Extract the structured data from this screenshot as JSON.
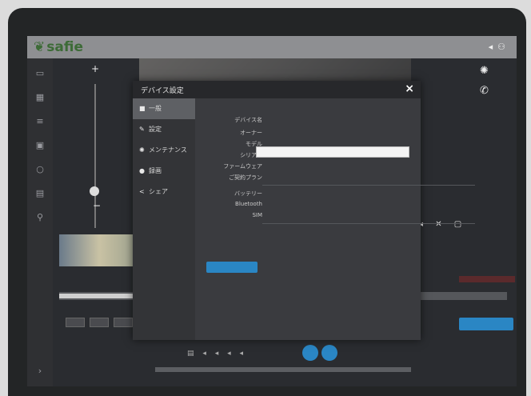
{
  "app": {
    "logo": "safie"
  },
  "dialog": {
    "title": "デバイス設定",
    "close_icon": "×",
    "nav": [
      {
        "icon": "info-icon",
        "label": "一般"
      },
      {
        "icon": "wrench-icon",
        "label": "設定"
      },
      {
        "icon": "gear-icon",
        "label": "メンテナンス"
      },
      {
        "icon": "record-icon",
        "label": "録画"
      },
      {
        "icon": "share-icon",
        "label": "シェア"
      }
    ],
    "fields": [
      {
        "label": "デバイス名",
        "value": ""
      },
      {
        "label": "オーナー",
        "value": ""
      },
      {
        "label": "モデル",
        "value": ""
      },
      {
        "label": "シリアル",
        "value": ""
      },
      {
        "label": "ファームウェア",
        "value": ""
      },
      {
        "label": "ご契約プラン",
        "value": ""
      }
    ],
    "status": [
      {
        "label": "バッテリー",
        "value": ""
      },
      {
        "label": "Bluetooth",
        "value": ""
      },
      {
        "label": "SIM",
        "value": ""
      }
    ],
    "primary_button": ""
  },
  "colors": {
    "accent": "#2a86c4",
    "topbar": "#8e8f92",
    "dialog": "#3a3b3f"
  }
}
